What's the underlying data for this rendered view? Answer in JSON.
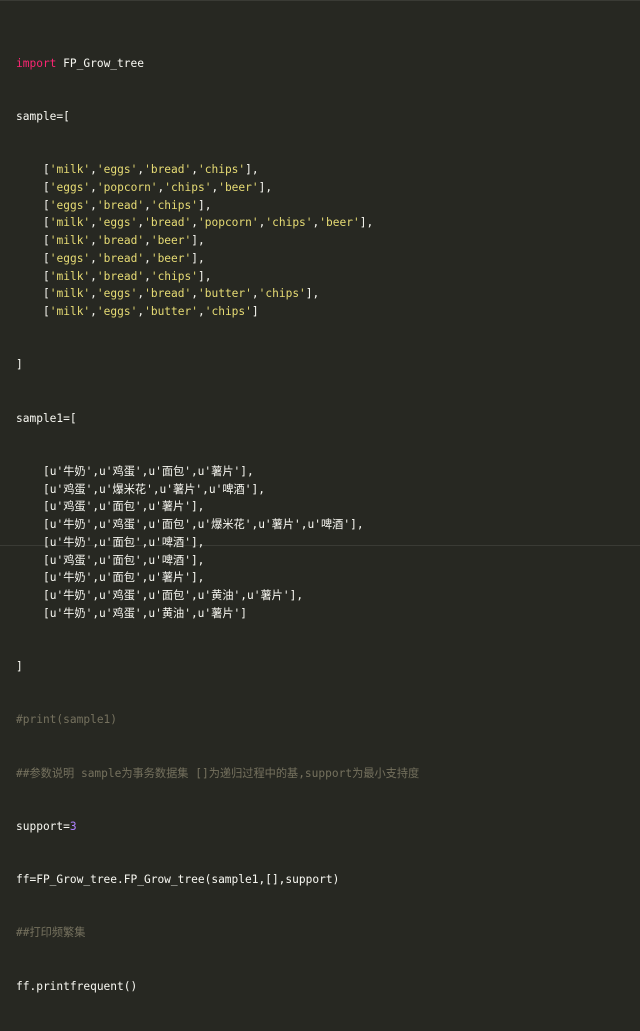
{
  "code": {
    "line1": {
      "keyword": "import",
      "rest": " FP_Grow_tree"
    },
    "line2": "sample=[",
    "sample_rows": [
      [
        [
          "["
        ],
        [
          "'milk'"
        ],
        [
          ","
        ],
        [
          "'eggs'"
        ],
        [
          ","
        ],
        [
          "'bread'"
        ],
        [
          ","
        ],
        [
          "'chips'"
        ],
        [
          "],"
        ]
      ],
      [
        [
          "["
        ],
        [
          "'eggs'"
        ],
        [
          ","
        ],
        [
          "'popcorn'"
        ],
        [
          ","
        ],
        [
          "'chips'"
        ],
        [
          ","
        ],
        [
          "'beer'"
        ],
        [
          "],"
        ]
      ],
      [
        [
          "["
        ],
        [
          "'eggs'"
        ],
        [
          ","
        ],
        [
          "'bread'"
        ],
        [
          ","
        ],
        [
          "'chips'"
        ],
        [
          "],"
        ]
      ],
      [
        [
          "["
        ],
        [
          "'milk'"
        ],
        [
          ","
        ],
        [
          "'eggs'"
        ],
        [
          ","
        ],
        [
          "'bread'"
        ],
        [
          ","
        ],
        [
          "'popcorn'"
        ],
        [
          ","
        ],
        [
          "'chips'"
        ],
        [
          ","
        ],
        [
          "'beer'"
        ],
        [
          "],"
        ]
      ],
      [
        [
          "["
        ],
        [
          "'milk'"
        ],
        [
          ","
        ],
        [
          "'bread'"
        ],
        [
          ","
        ],
        [
          "'beer'"
        ],
        [
          "],"
        ]
      ],
      [
        [
          "["
        ],
        [
          "'eggs'"
        ],
        [
          ","
        ],
        [
          "'bread'"
        ],
        [
          ","
        ],
        [
          "'beer'"
        ],
        [
          "],"
        ]
      ],
      [
        [
          "["
        ],
        [
          "'milk'"
        ],
        [
          ","
        ],
        [
          "'bread'"
        ],
        [
          ","
        ],
        [
          "'chips'"
        ],
        [
          "],"
        ]
      ],
      [
        [
          "["
        ],
        [
          "'milk'"
        ],
        [
          ","
        ],
        [
          "'eggs'"
        ],
        [
          ","
        ],
        [
          "'bread'"
        ],
        [
          ","
        ],
        [
          "'butter'"
        ],
        [
          ","
        ],
        [
          "'chips'"
        ],
        [
          "],"
        ]
      ],
      [
        [
          "["
        ],
        [
          "'milk'"
        ],
        [
          ","
        ],
        [
          "'eggs'"
        ],
        [
          ","
        ],
        [
          "'butter'"
        ],
        [
          ","
        ],
        [
          "'chips'"
        ],
        [
          "]"
        ]
      ]
    ],
    "close1": "]",
    "line_sample1": "sample1=[",
    "sample1_rows": [
      [
        "[u'牛奶',u'鸡蛋',u'面包',u'薯片'],"
      ],
      [
        "[u'鸡蛋',u'爆米花',u'薯片',u'啤酒'],"
      ],
      [
        "[u'鸡蛋',u'面包',u'薯片'],"
      ],
      [
        "[u'牛奶',u'鸡蛋',u'面包',u'爆米花',u'薯片',u'啤酒'],"
      ],
      [
        "[u'牛奶',u'面包',u'啤酒'],"
      ],
      [
        "[u'鸡蛋',u'面包',u'啤酒'],"
      ],
      [
        "[u'牛奶',u'面包',u'薯片'],"
      ],
      [
        "[u'牛奶',u'鸡蛋',u'面包',u'黄油',u'薯片'],"
      ],
      [
        "[u'牛奶',u'鸡蛋',u'黄油',u'薯片']"
      ]
    ],
    "close2": "]",
    "comment_print": "#print(sample1)",
    "comment_params": "##参数说明 sample为事务数据集 []为递归过程中的基,support为最小支持度",
    "support_prefix": "support=",
    "support_value": "3",
    "ff_line": "ff=FP_Grow_tree.FP_Grow_tree(sample1,[],support)",
    "comment_freq": "##打印频繁集",
    "print_line": "ff.printfrequent()"
  },
  "colors": {
    "background": "#272822",
    "keyword": "#f92672",
    "string": "#e6db74",
    "number": "#ae81ff",
    "comment": "#75715e",
    "plain": "#f8f8f2"
  }
}
